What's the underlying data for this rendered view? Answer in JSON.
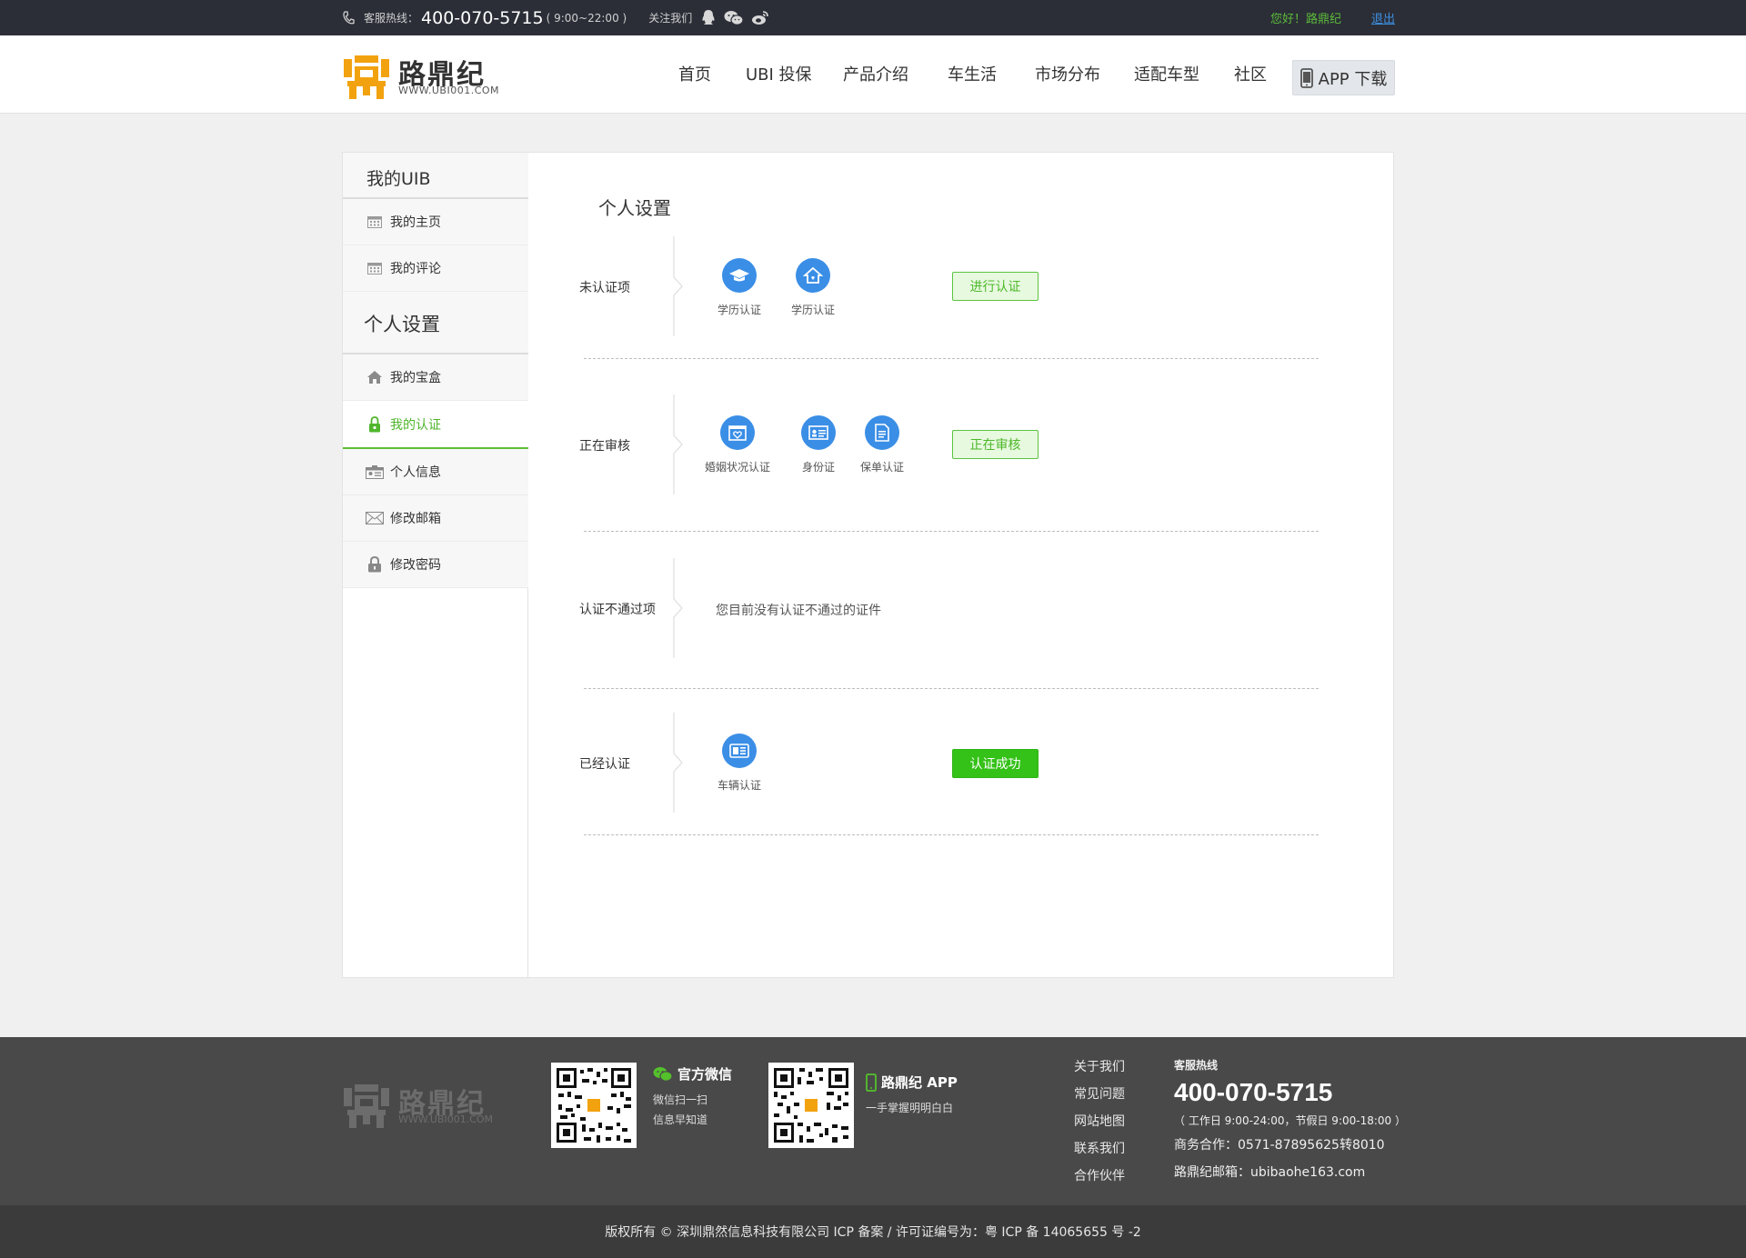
{
  "topbar": {
    "hotline_label": "客服热线：",
    "hotline_number": "400-070-5715",
    "hotline_hours": "( 9:00~22:00 )",
    "follow_label": "关注我们",
    "greeting": "您好！路鼎纪",
    "logout": "退出"
  },
  "header": {
    "logo_name": "路鼎纪",
    "logo_url": "WWW.UBI001.COM",
    "nav": [
      "首页",
      "UBI 投保",
      "产品介绍",
      "车生活",
      "市场分布",
      "适配车型",
      "社区"
    ],
    "app_download": "APP 下载"
  },
  "sidebar": {
    "section1_title": "我的UIB",
    "section1_items": [
      {
        "label": "我的主页",
        "icon": "calendar-icon"
      },
      {
        "label": "我的评论",
        "icon": "calendar-icon"
      }
    ],
    "section2_title": "个人设置",
    "section2_items": [
      {
        "label": "我的宝盒",
        "icon": "home-icon"
      },
      {
        "label": "我的认证",
        "icon": "lock-icon",
        "active": true
      },
      {
        "label": "个人信息",
        "icon": "id-card-icon"
      },
      {
        "label": "修改邮箱",
        "icon": "envelope-icon"
      },
      {
        "label": "修改密码",
        "icon": "padlock-icon"
      }
    ]
  },
  "content": {
    "title": "个人设置",
    "rows": [
      {
        "label": "未认证项",
        "items": [
          {
            "name": "学历认证",
            "icon": "graduation-cap-icon"
          },
          {
            "name": "学历认证",
            "icon": "house-icon"
          }
        ],
        "button": "进行认证"
      },
      {
        "label": "正在审核",
        "items": [
          {
            "name": "婚姻状况认证",
            "icon": "heart-calendar-icon"
          },
          {
            "name": "身份证",
            "icon": "id-card-icon"
          },
          {
            "name": "保单认证",
            "icon": "document-icon"
          }
        ],
        "button": "正在审核"
      },
      {
        "label": "认证不通过项",
        "empty_text": "您目前没有认证不通过的证件"
      },
      {
        "label": "已经认证",
        "items": [
          {
            "name": "车辆认证",
            "icon": "vehicle-license-icon"
          }
        ],
        "button": "认证成功"
      }
    ]
  },
  "footer": {
    "logo_name": "路鼎纪",
    "logo_url": "WWW.UBI001.COM",
    "wechat_title": "官方微信",
    "wechat_sub1": "微信扫一扫",
    "wechat_sub2": "信息早知道",
    "app_title": "路鼎纪 APP",
    "app_sub": "一手掌握明明白白",
    "links": [
      "关于我们",
      "常见问题",
      "网站地图",
      "联系我们",
      "合作伙伴"
    ],
    "contact_label": "客服热线",
    "contact_number": "400-070-5715",
    "contact_hours": "（ 工作日 9:00-24:00，节假日 9:00-18:00 ）",
    "business": "商务合作：0571-87895625转8010",
    "email": "路鼎纪邮箱：ubibaohe163.com",
    "copyright": "版权所有 © 深圳鼎然信息科技有限公司 ICP 备案 / 许可证编号为：粤 ICP 备 14065655 号 -2"
  },
  "colors": {
    "accent_green": "#34c118",
    "icon_blue": "#3a8ee6",
    "topbar_bg": "#2b2e37",
    "footer_bg": "#494949"
  }
}
